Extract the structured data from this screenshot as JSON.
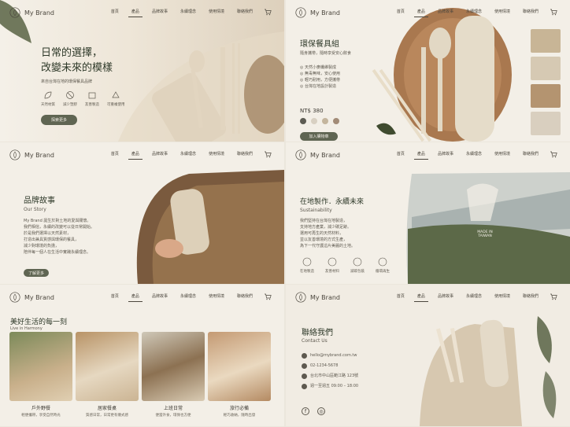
{
  "brand": "My Brand",
  "nav": [
    "首頁",
    "產品",
    "品牌故事",
    "永續理念",
    "使用情境",
    "聯絡我們"
  ],
  "hero": {
    "title_line1": "日常的選擇，",
    "title_line2": "改變未來的模樣",
    "subtitle": "來自台灣在地的環保餐具品牌",
    "features": [
      "天然材質",
      "減少塑膠",
      "友善製造",
      "可重複使用"
    ],
    "button": "探索更多"
  },
  "product": {
    "title": "環保餐具組",
    "subtitle": "隨身攜帶，隨時享受安心飲食",
    "points": [
      "天然小麥纖維製成",
      "無毒無味，安心使用",
      "輕巧耐用，方便攜帶",
      "台灣在地設計製造"
    ],
    "price": "NT$ 380",
    "button": "加入購物車"
  },
  "story": {
    "title": "品牌故事",
    "title_en": "Our Story",
    "body": [
      "My Brand 誕生於對土地的愛與關懷。",
      "我們相信，永續的改變可以從日常開始。",
      "於是我們選擇以天然素材，",
      "打造出兼具質感與環保的餐具，",
      "減少對環境的負擔，",
      "陪伴每一個人在生活中實踐永續理念。"
    ],
    "button": "了解更多"
  },
  "sustain": {
    "title": "在地製作．永續未來",
    "title_en": "Sustainability",
    "body": [
      "我們堅持在台灣在地製造，",
      "支持地方產業，減少碳足跡。",
      "選用可再生的天然材料，",
      "並以友善環境的方式生產，",
      "為下一代守護這片美麗的土地。"
    ],
    "stamp_line1": "MADE IN",
    "stamp_line2": "TAIWAN",
    "features": [
      "在地製造",
      "友善材料",
      "減碳包裝",
      "循環再生"
    ]
  },
  "life": {
    "title": "美好生活的每一刻",
    "title_en": "Live in Harmony",
    "cards": [
      {
        "t": "戶外野餐",
        "s": "輕便攜帶，享受自然時光"
      },
      {
        "t": "居家餐桌",
        "s": "質感日常，日常更有儀式感"
      },
      {
        "t": "上班日常",
        "s": "便當外食，環保也方便"
      },
      {
        "t": "旅行必備",
        "s": "輕巧收納，隨時出發"
      }
    ]
  },
  "contact": {
    "title": "聯絡我們",
    "title_en": "Contact Us",
    "email": "hello@mybrand.com.tw",
    "phone": "02-1234-5678",
    "address": "台北市中山區範江路 123號",
    "hours": "週一至週五 09:00 – 18:00"
  },
  "colors": {
    "bg": "#f3efe7",
    "accent": "#5f6552",
    "text": "#3d3a33",
    "swatches": [
      "#5d5c53",
      "#d8d0c2",
      "#c4b59d",
      "#a28b77"
    ]
  }
}
